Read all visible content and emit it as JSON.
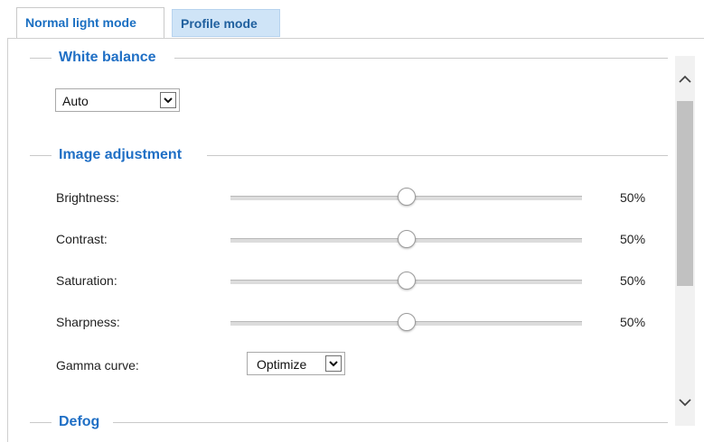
{
  "tabs": [
    {
      "label": "Normal light mode",
      "active": true
    },
    {
      "label": "Profile mode",
      "active": false
    }
  ],
  "white_balance": {
    "title": "White balance",
    "selected": "Auto"
  },
  "image_adjustment": {
    "title": "Image adjustment",
    "sliders": [
      {
        "label": "Brightness:",
        "value": 50,
        "display": "50%"
      },
      {
        "label": "Contrast:",
        "value": 50,
        "display": "50%"
      },
      {
        "label": "Saturation:",
        "value": 50,
        "display": "50%"
      },
      {
        "label": "Sharpness:",
        "value": 50,
        "display": "50%"
      }
    ],
    "gamma": {
      "label": "Gamma curve:",
      "selected": "Optimize"
    }
  },
  "defog": {
    "title": "Defog"
  },
  "icons": {
    "scroll_up": "chevron-up-icon",
    "scroll_down": "chevron-down-icon",
    "dropdown": "chevron-down-icon"
  },
  "colors": {
    "accent": "#1f6fc5",
    "inactive_tab_bg": "#cfe4f7"
  }
}
